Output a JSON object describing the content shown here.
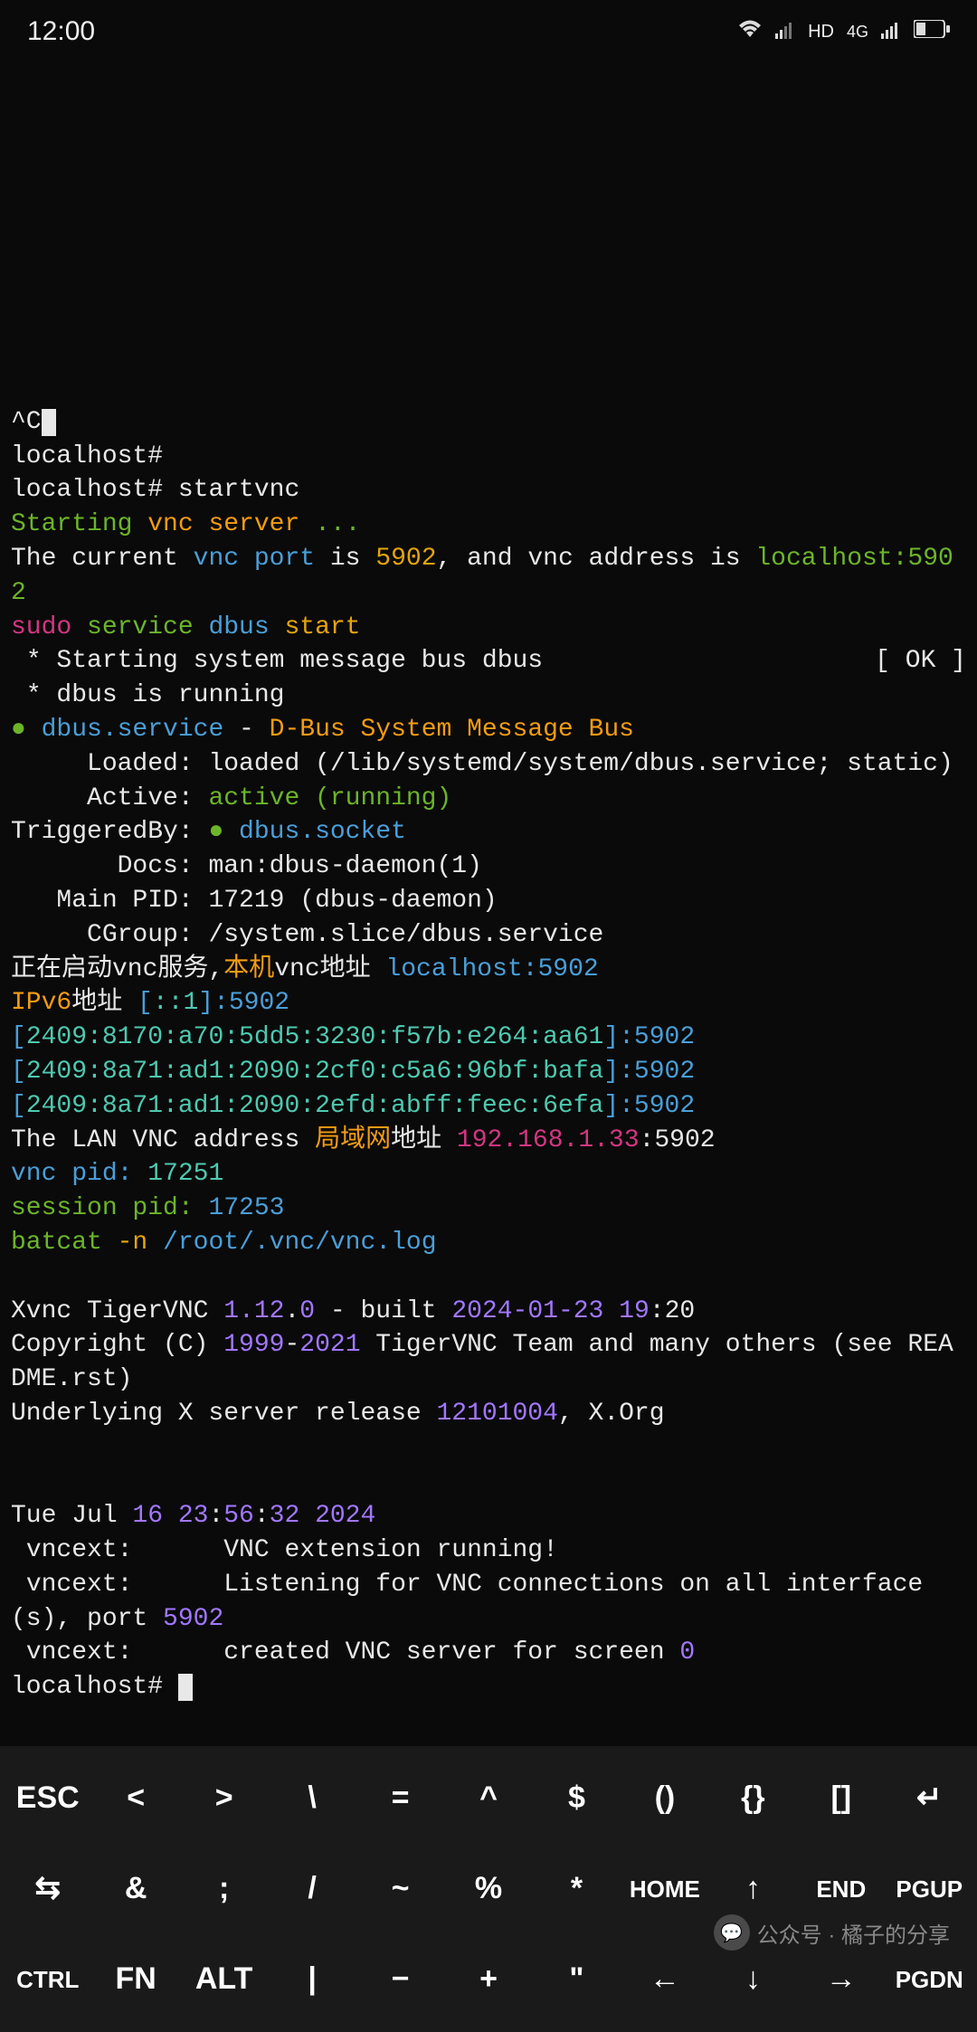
{
  "status": {
    "time": "12:00",
    "network": "4G",
    "hd": "HD"
  },
  "terminal": {
    "l0a": "^C",
    "l1": "localhost#",
    "l2a": "localhost# ",
    "l2b": "startvnc",
    "l3a": "Starting ",
    "l3b": "vnc server ",
    "l3c": "...",
    "l4a": "The current ",
    "l4b": "vnc port ",
    "l4c": "is ",
    "l4d": "5902",
    "l4e": ", and vnc address is ",
    "l4f": "localhost:5902",
    "l5a": "sudo",
    "l5b": " service",
    "l5c": " dbus",
    "l5d": " start",
    "l6a": " * Starting system message bus dbus",
    "l6b": "[ OK ]",
    "l7": " * dbus is running",
    "l8a": "●",
    "l8b": " dbus.service",
    "l8c": " - ",
    "l8d": "D-Bus System Message Bus",
    "l9": "     Loaded: loaded (/lib/systemd/system/dbus.service; static)",
    "l10a": "     Active: ",
    "l10b": "active (running)",
    "l11a": "TriggeredBy: ",
    "l11b": "●",
    "l11c": " dbus.socket",
    "l12": "       Docs: man:dbus-daemon(1)",
    "l13": "   Main PID: 17219 (dbus-daemon)",
    "l14": "     CGroup: /system.slice/dbus.service",
    "l15a": "正在启动vnc服务,",
    "l15b": "本机",
    "l15c": "vnc地址 ",
    "l15d": "localhost:5902",
    "l16a": "IPv6",
    "l16b": "地址 ",
    "l16c": "[",
    "l16d": "::1",
    "l16e": "]:5902",
    "l17a": "[",
    "l17b": "2409:8170:a70:5dd5:3230:f57b:e264:aa61",
    "l17c": "]:5902",
    "l18a": "[",
    "l18b": "2409:8a71:ad1:2090:2cf0:c5a6:96bf:bafa",
    "l18c": "]:5902",
    "l19a": "[",
    "l19b": "2409:8a71:ad1:2090:2efd:abff:feec:6efa",
    "l19c": "]:5902",
    "l20a": "The LAN VNC address ",
    "l20b": "局域网",
    "l20c": "地址 ",
    "l20d": "192.168.1.33",
    "l20e": ":5902",
    "l21a": "vnc pid: ",
    "l21b": "17251",
    "l22a": "session pid: ",
    "l22b": "17253",
    "l23a": "batcat ",
    "l23b": "-n ",
    "l23c": "/root/.vnc/vnc.log",
    "l24a": "Xvnc TigerVNC ",
    "l24b": "1.12",
    "l24c": ".",
    "l24d": "0",
    "l24e": " - built ",
    "l24f": "2024-01-23 19",
    "l24g": ":20",
    "l25a": "Copyright (C) ",
    "l25b": "1999",
    "l25c": "-",
    "l25d": "2021",
    "l25e": " TigerVNC Team and many others (see README.rst)",
    "l26a": "Underlying X server release ",
    "l26b": "12101004",
    "l26c": ", X.Org",
    "l27a": "Tue Jul ",
    "l27b": "16 23",
    "l27c": ":",
    "l27d": "56",
    "l27e": ":",
    "l27f": "32 2024",
    "l28": " vncext:      VNC extension running!",
    "l29a": " vncext:      Listening for VNC connections on all interface(s), port ",
    "l29b": "5902",
    "l30a": " vncext:      created VNC server for screen ",
    "l30b": "0",
    "l31": "localhost# "
  },
  "keys": {
    "r1": [
      "ESC",
      "<",
      ">",
      "\\",
      "=",
      "^",
      "$",
      "()",
      "{}",
      "[]",
      "↵"
    ],
    "r2": [
      "⇆",
      "&",
      ";",
      "/",
      "~",
      "%",
      "*",
      "HOME",
      "↑",
      "END",
      "PGUP"
    ],
    "r3": [
      "CTRL",
      "FN",
      "ALT",
      "|",
      "−",
      "+",
      "\"",
      "←",
      "↓",
      "→",
      "PGDN"
    ]
  },
  "watermark": "公众号 · 橘子的分享"
}
